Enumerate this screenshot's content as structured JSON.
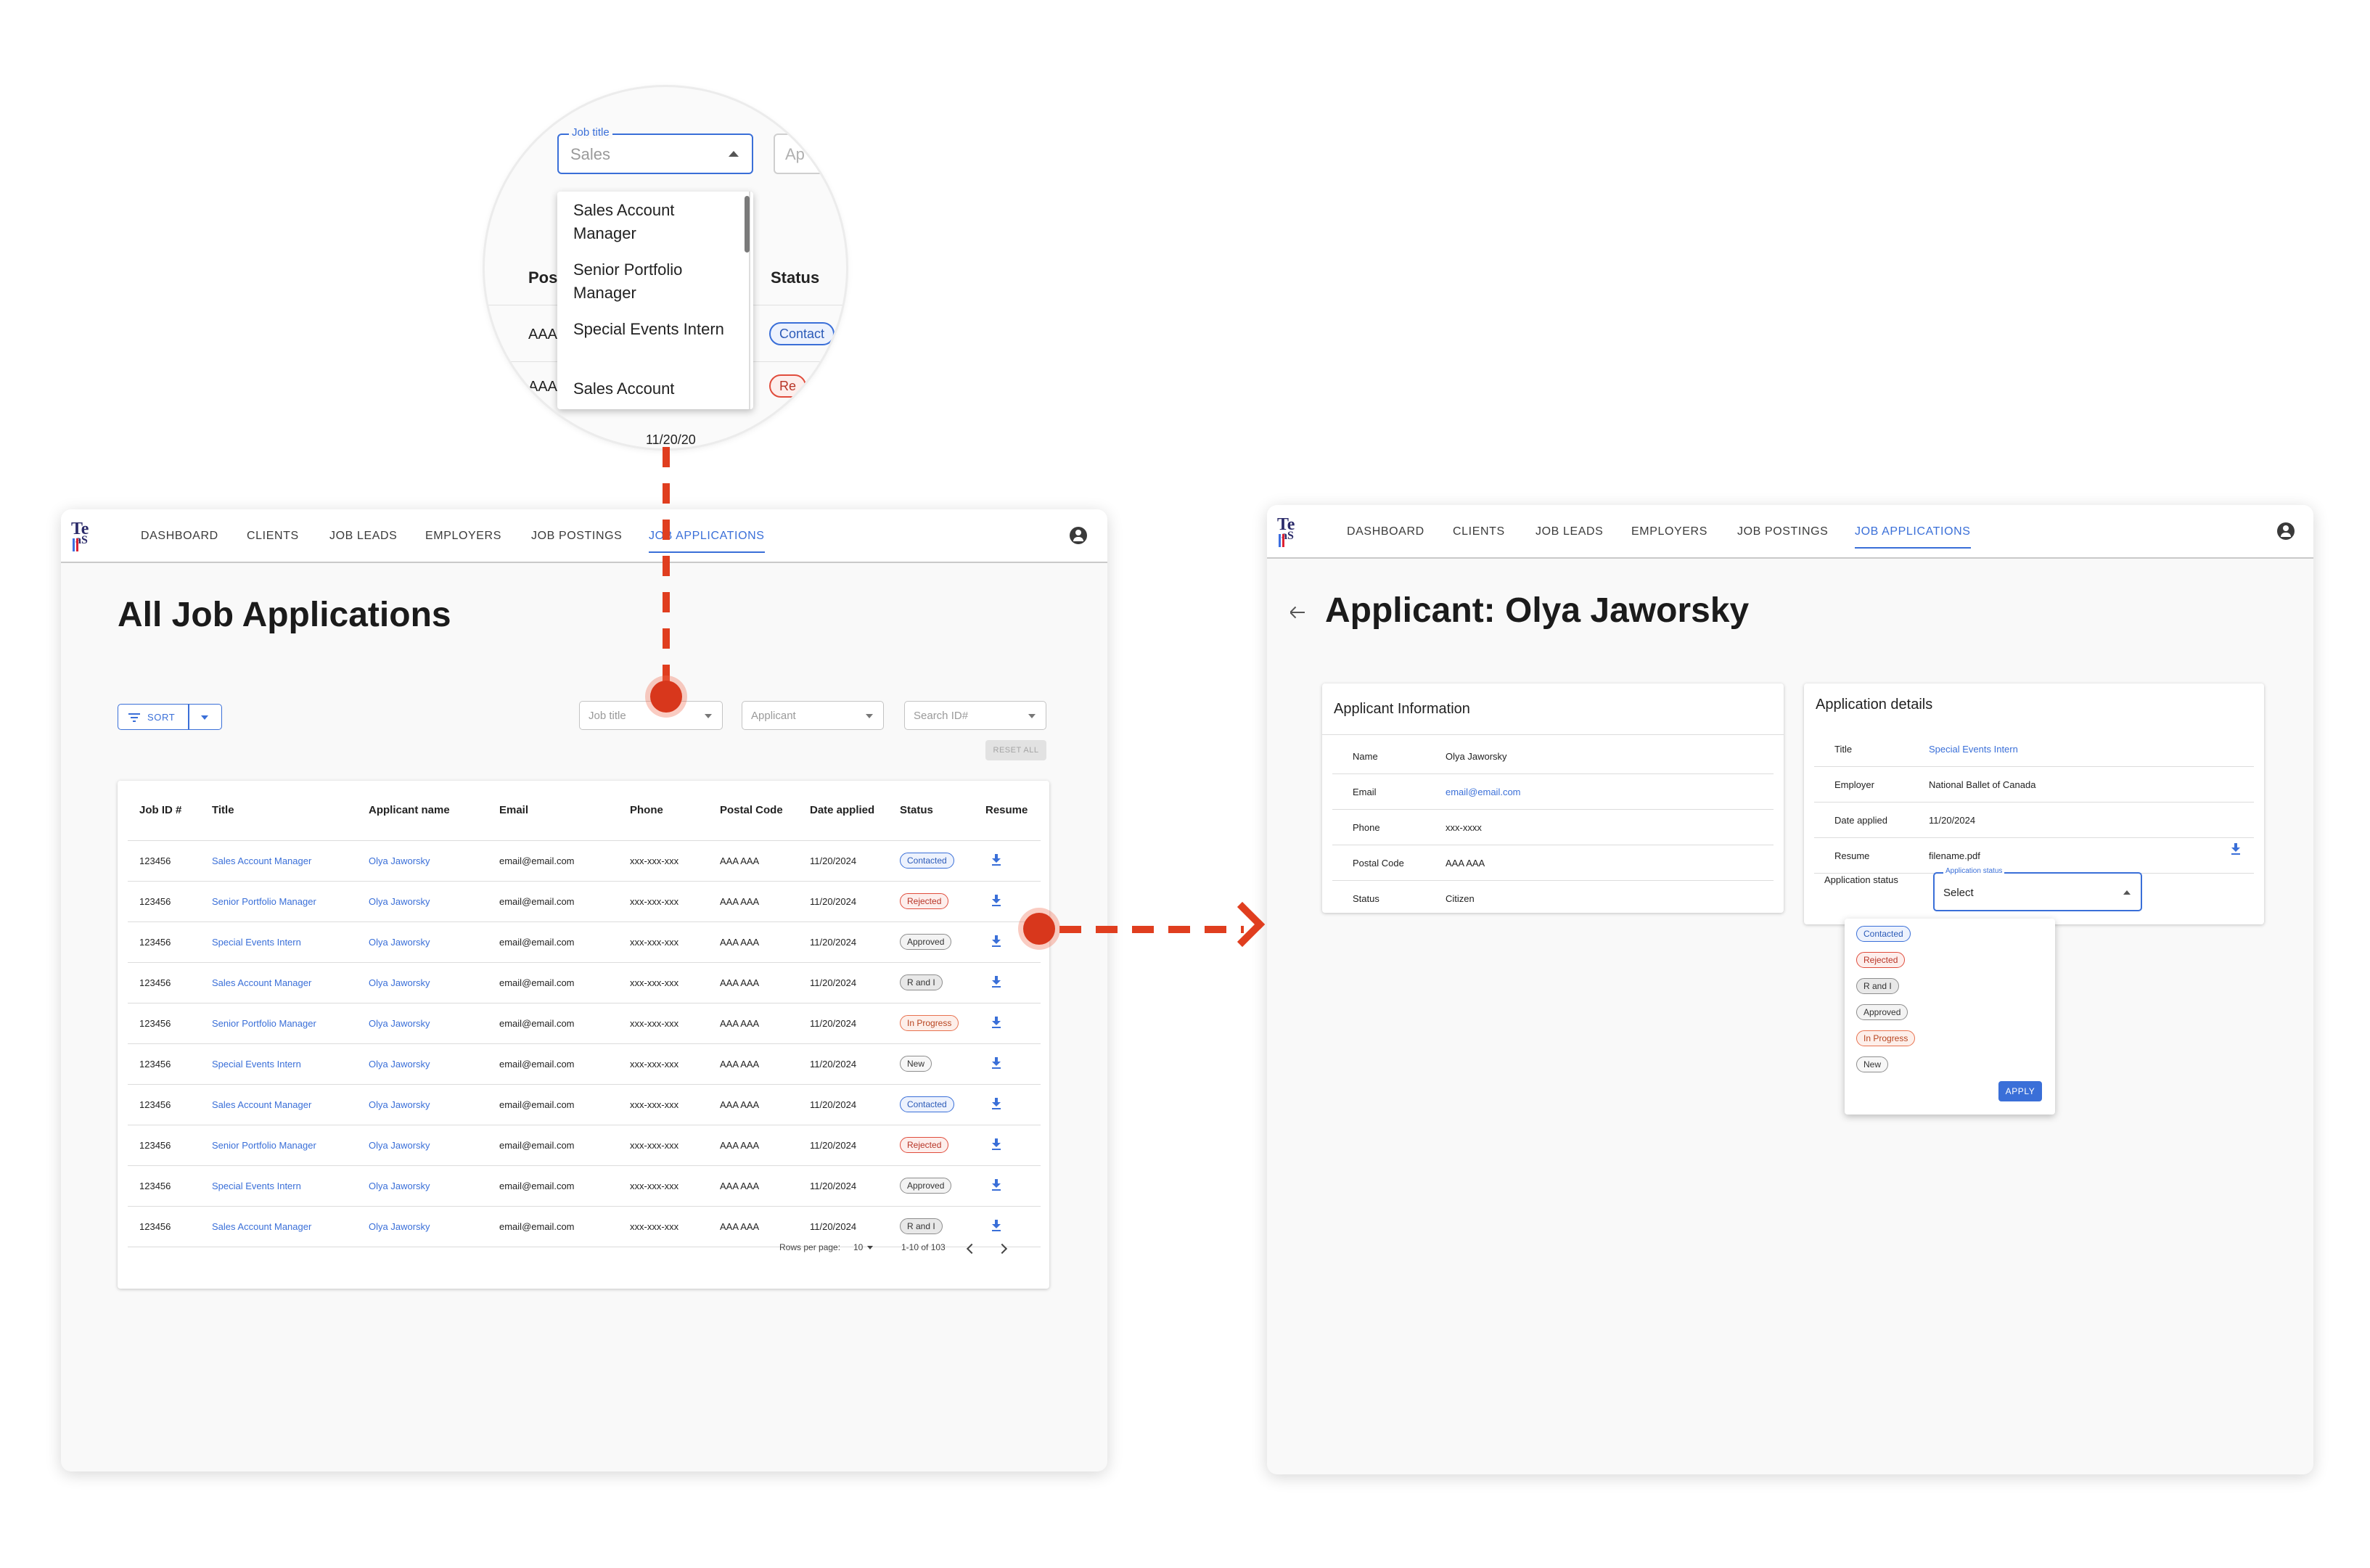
{
  "nav": {
    "items": [
      "DASHBOARD",
      "CLIENTS",
      "JOB LEADS",
      "EMPLOYERS",
      "JOB POSTINGS",
      "JOB APPLICATIONS"
    ],
    "active": "JOB APPLICATIONS",
    "logo_text_1": "Te",
    "logo_text_2": "aS"
  },
  "list_page": {
    "title": "All Job Applications",
    "sort_label": "SORT",
    "filters": {
      "job_title_placeholder": "Job title",
      "applicant_placeholder": "Applicant",
      "search_placeholder": "Search ID#"
    },
    "reset_label": "RESET ALL",
    "columns": [
      "Job ID #",
      "Title",
      "Applicant name",
      "Email",
      "Phone",
      "Postal Code",
      "Date applied",
      "Status",
      "Resume"
    ],
    "rows": [
      {
        "id": "123456",
        "title": "Sales Account Manager",
        "applicant": "Olya Jaworsky",
        "email": "email@email.com",
        "phone": "xxx-xxx-xxx",
        "postal": "AAA AAA",
        "date": "11/20/2024",
        "status": "Contacted",
        "status_key": "contacted"
      },
      {
        "id": "123456",
        "title": "Senior Portfolio Manager",
        "applicant": "Olya Jaworsky",
        "email": "email@email.com",
        "phone": "xxx-xxx-xxx",
        "postal": "AAA AAA",
        "date": "11/20/2024",
        "status": "Rejected",
        "status_key": "rejected"
      },
      {
        "id": "123456",
        "title": "Special Events Intern",
        "applicant": "Olya Jaworsky",
        "email": "email@email.com",
        "phone": "xxx-xxx-xxx",
        "postal": "AAA AAA",
        "date": "11/20/2024",
        "status": "Approved",
        "status_key": "approved"
      },
      {
        "id": "123456",
        "title": "Sales Account Manager",
        "applicant": "Olya Jaworsky",
        "email": "email@email.com",
        "phone": "xxx-xxx-xxx",
        "postal": "AAA AAA",
        "date": "11/20/2024",
        "status": "R and I",
        "status_key": "randi"
      },
      {
        "id": "123456",
        "title": "Senior Portfolio Manager",
        "applicant": "Olya Jaworsky",
        "email": "email@email.com",
        "phone": "xxx-xxx-xxx",
        "postal": "AAA AAA",
        "date": "11/20/2024",
        "status": "In Progress",
        "status_key": "inprogress"
      },
      {
        "id": "123456",
        "title": "Special Events Intern",
        "applicant": "Olya Jaworsky",
        "email": "email@email.com",
        "phone": "xxx-xxx-xxx",
        "postal": "AAA AAA",
        "date": "11/20/2024",
        "status": "New",
        "status_key": "new"
      },
      {
        "id": "123456",
        "title": "Sales Account Manager",
        "applicant": "Olya Jaworsky",
        "email": "email@email.com",
        "phone": "xxx-xxx-xxx",
        "postal": "AAA AAA",
        "date": "11/20/2024",
        "status": "Contacted",
        "status_key": "contacted"
      },
      {
        "id": "123456",
        "title": "Senior Portfolio Manager",
        "applicant": "Olya Jaworsky",
        "email": "email@email.com",
        "phone": "xxx-xxx-xxx",
        "postal": "AAA AAA",
        "date": "11/20/2024",
        "status": "Rejected",
        "status_key": "rejected"
      },
      {
        "id": "123456",
        "title": "Special Events Intern",
        "applicant": "Olya Jaworsky",
        "email": "email@email.com",
        "phone": "xxx-xxx-xxx",
        "postal": "AAA AAA",
        "date": "11/20/2024",
        "status": "Approved",
        "status_key": "approved"
      },
      {
        "id": "123456",
        "title": "Sales Account Manager",
        "applicant": "Olya Jaworsky",
        "email": "email@email.com",
        "phone": "xxx-xxx-xxx",
        "postal": "AAA AAA",
        "date": "11/20/2024",
        "status": "R and I",
        "status_key": "randi"
      }
    ],
    "pagination": {
      "rows_per_page_label": "Rows per page:",
      "rows_per_page_value": "10",
      "range": "1-10 of 103"
    }
  },
  "magnifier": {
    "field_label": "Job title",
    "field_value": "Sales",
    "next_field_placeholder": "Ap",
    "options": [
      "Sales Account Manager",
      "Senior Portfolio Manager",
      "Special Events Intern",
      "Sales Account"
    ],
    "bg_header_pos": "Pos",
    "bg_header_status": "Status",
    "bg_cell_1": "AAA",
    "bg_cell_2": "AAA",
    "bg_badge_1": "Contact",
    "bg_badge_2": "Re",
    "bg_date": "11/20/20"
  },
  "detail_page": {
    "title": "Applicant: Olya Jaworsky",
    "applicant_info": {
      "heading": "Applicant Information",
      "fields": [
        {
          "label": "Name",
          "value": "Olya Jaworsky"
        },
        {
          "label": "Email",
          "value": "email@email.com"
        },
        {
          "label": "Phone",
          "value": "xxx-xxxx"
        },
        {
          "label": "Postal Code",
          "value": "AAA AAA"
        },
        {
          "label": "Status",
          "value": "Citizen"
        }
      ]
    },
    "application_details": {
      "heading": "Application details",
      "fields": [
        {
          "label": "Title",
          "value": "Special Events Intern"
        },
        {
          "label": "Employer",
          "value": "National Ballet of Canada"
        },
        {
          "label": "Date applied",
          "value": "11/20/2024"
        },
        {
          "label": "Resume",
          "value": "filename.pdf"
        }
      ],
      "status_label": "Application status",
      "status_field_label": "Application status",
      "status_value": "Select",
      "status_options": [
        "Contacted",
        "Rejected",
        "R and I",
        "Approved",
        "In Progress",
        "New"
      ],
      "status_option_keys": [
        "contacted",
        "rejected",
        "randi",
        "approved",
        "inprogress",
        "new"
      ],
      "apply_label": "APPLY"
    }
  },
  "colors": {
    "accent": "#3a6fd8",
    "annotation": "#e03e1f"
  }
}
